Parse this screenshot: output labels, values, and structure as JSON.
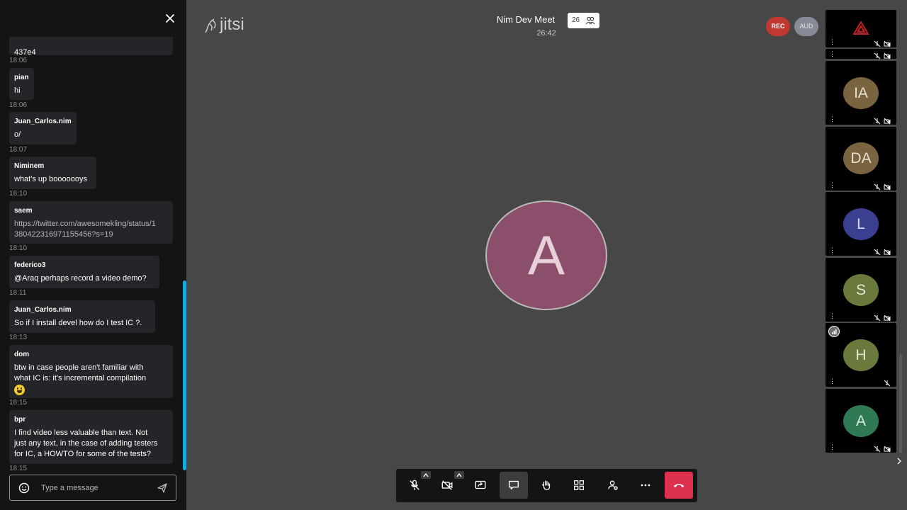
{
  "chat": {
    "messages": [
      {
        "sender": "",
        "body_lines": [
          "",
          "437e4"
        ],
        "time": "18:06"
      },
      {
        "sender": "pian",
        "body": "hi",
        "time": "18:06"
      },
      {
        "sender": "Juan_Carlos.nim",
        "body": "o/",
        "time": "18:07"
      },
      {
        "sender": "Niminem",
        "body": "what's up booooooys",
        "time": "18:10"
      },
      {
        "sender": "saem",
        "body_lines": [
          "https://twitter.com/awesomekling/status/1",
          "380422316971155456?s=19"
        ],
        "time": "18:10"
      },
      {
        "sender": "federico3",
        "body": "@Araq perhaps record a video demo?",
        "time": "18:11"
      },
      {
        "sender": "Juan_Carlos.nim",
        "body": "So if I install devel how do I test IC ?.",
        "time": "18:13"
      },
      {
        "sender": "dom",
        "body_lines": [
          "btw in case people aren't familiar with",
          "what IC is: it's incremental compilation"
        ],
        "time": "18:15"
      },
      {
        "sender": "bpr",
        "body_lines": [
          "I find video less valuable than text. Not",
          "just any text, in the case of adding testers",
          "for IC, a HOWTO for some of the tests?"
        ],
        "time": "18:15"
      }
    ],
    "input_placeholder": "Type a message"
  },
  "header": {
    "logo_text": "jitsi",
    "meeting_title": "Nim Dev Meet",
    "timer": "26:42",
    "participant_count": "26",
    "rec_label": "REC",
    "aud_label": "AUD"
  },
  "stage": {
    "speaker_initial": "A",
    "speaker_color": "#8c4f6b"
  },
  "filmstrip": [
    {
      "initials": "",
      "color": "#000000"
    },
    {
      "initials": "IA",
      "color": "#7a6440"
    },
    {
      "initials": "DA",
      "color": "#7a6440"
    },
    {
      "initials": "L",
      "color": "#3b3f8f"
    },
    {
      "initials": "S",
      "color": "#6a7a3c"
    },
    {
      "initials": "H",
      "color": "#6a7a3c"
    },
    {
      "initials": "A",
      "color": "#2f7a55"
    }
  ],
  "colors": {
    "accent": "#1ca9d9",
    "rec": "#bf3931",
    "hangup": "#dd304d"
  },
  "toolbar_icons": [
    "mic-muted-icon",
    "camera-off-icon",
    "screen-share-icon",
    "chat-icon",
    "raise-hand-icon",
    "tile-view-icon",
    "invite-icon",
    "more-icon",
    "hangup-icon"
  ]
}
